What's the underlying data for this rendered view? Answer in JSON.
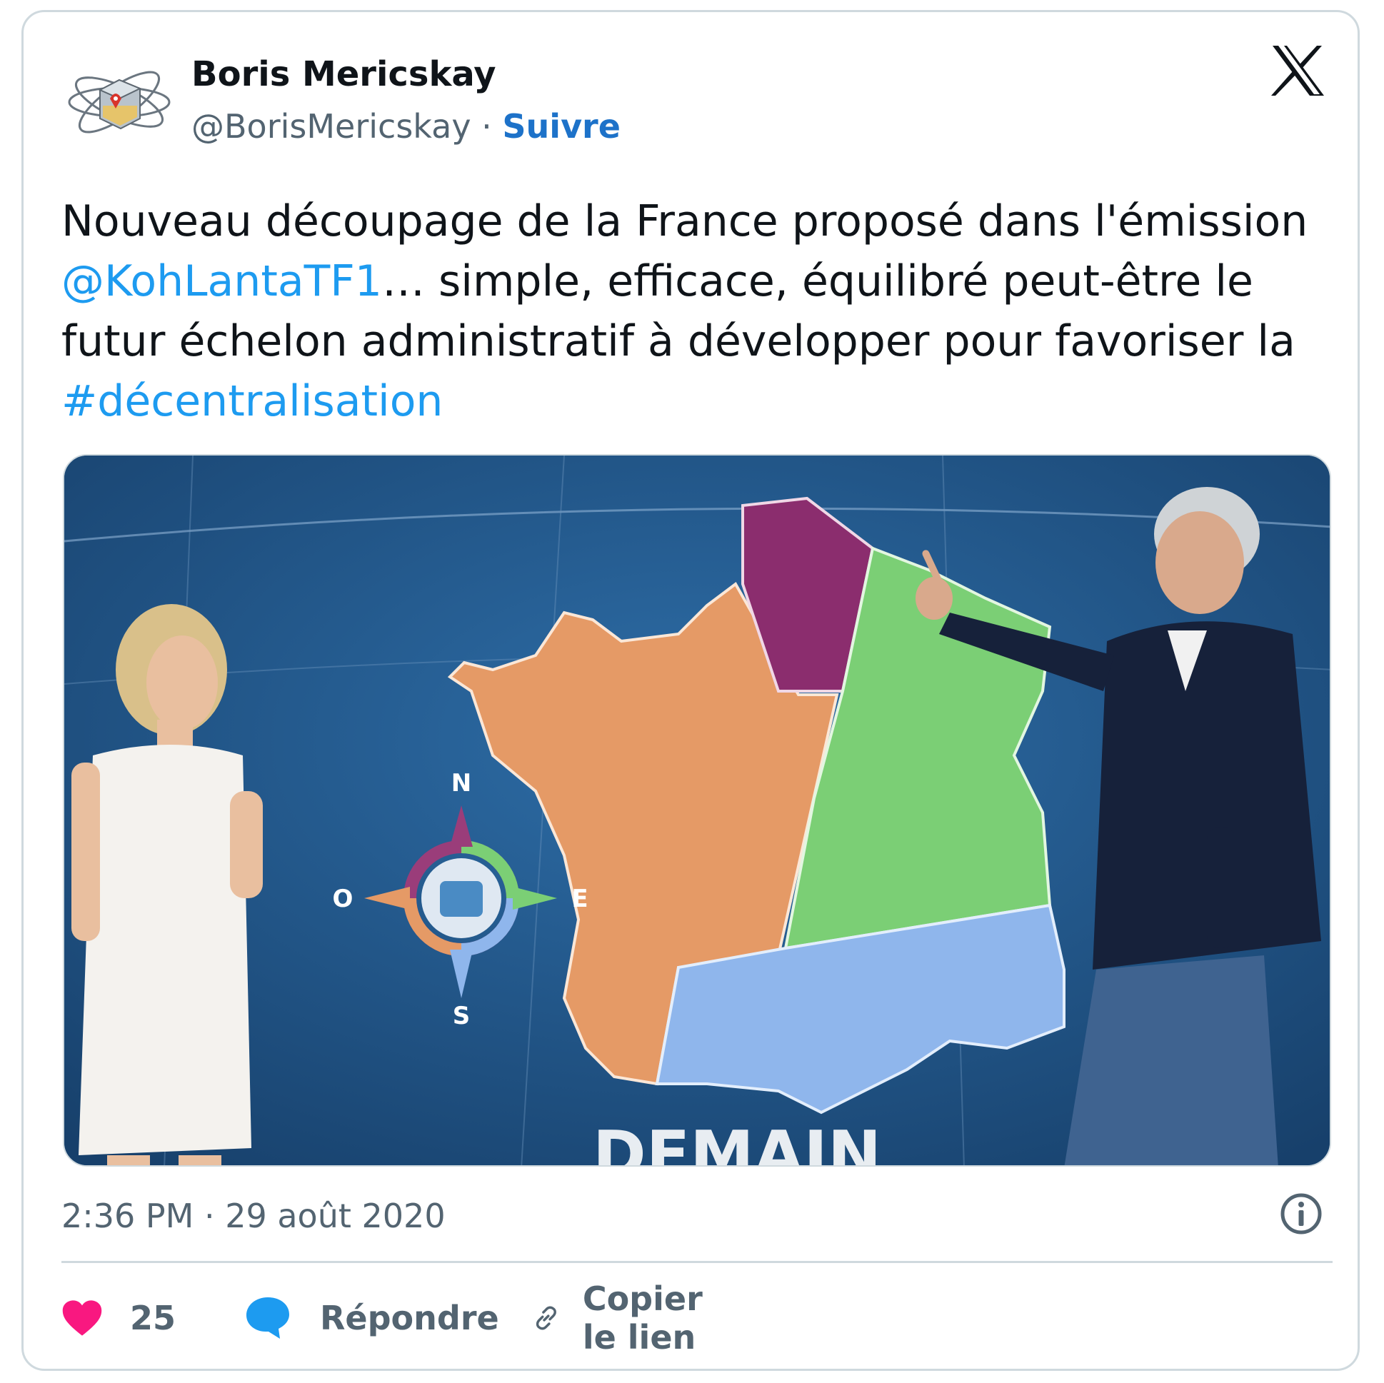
{
  "author": {
    "name": "Boris Mericskay",
    "handle": "@BorisMericskay",
    "separator": "·",
    "follow_label": "Suivre"
  },
  "tweet": {
    "text_1": "Nouveau découpage de la France proposé dans l'émission ",
    "mention": "@KohLantaTF1",
    "text_2": "… simple, efficace, équilibré peut-être le futur échelon administratif à développer pour favoriser la ",
    "hashtag": "#décentralisation"
  },
  "media": {
    "compass_n": "N",
    "compass_s": "S",
    "compass_e": "E",
    "compass_o": "O",
    "bottom_text": "DEMAIN",
    "region_colors": {
      "west": "#e59a66",
      "north": "#8b2d6e",
      "east": "#7bcf75",
      "south": "#8fb6ec"
    }
  },
  "timestamp": "2:36 PM · 29 août 2020",
  "actions": {
    "like_count": "25",
    "reply_label": "Répondre",
    "copy_link_label": "Copier le lien"
  },
  "colors": {
    "link": "#1d9bf0",
    "follow": "#1d72c9",
    "secondary_text": "#536471",
    "heart": "#f91880",
    "reply_bubble": "#1d9bf0"
  }
}
